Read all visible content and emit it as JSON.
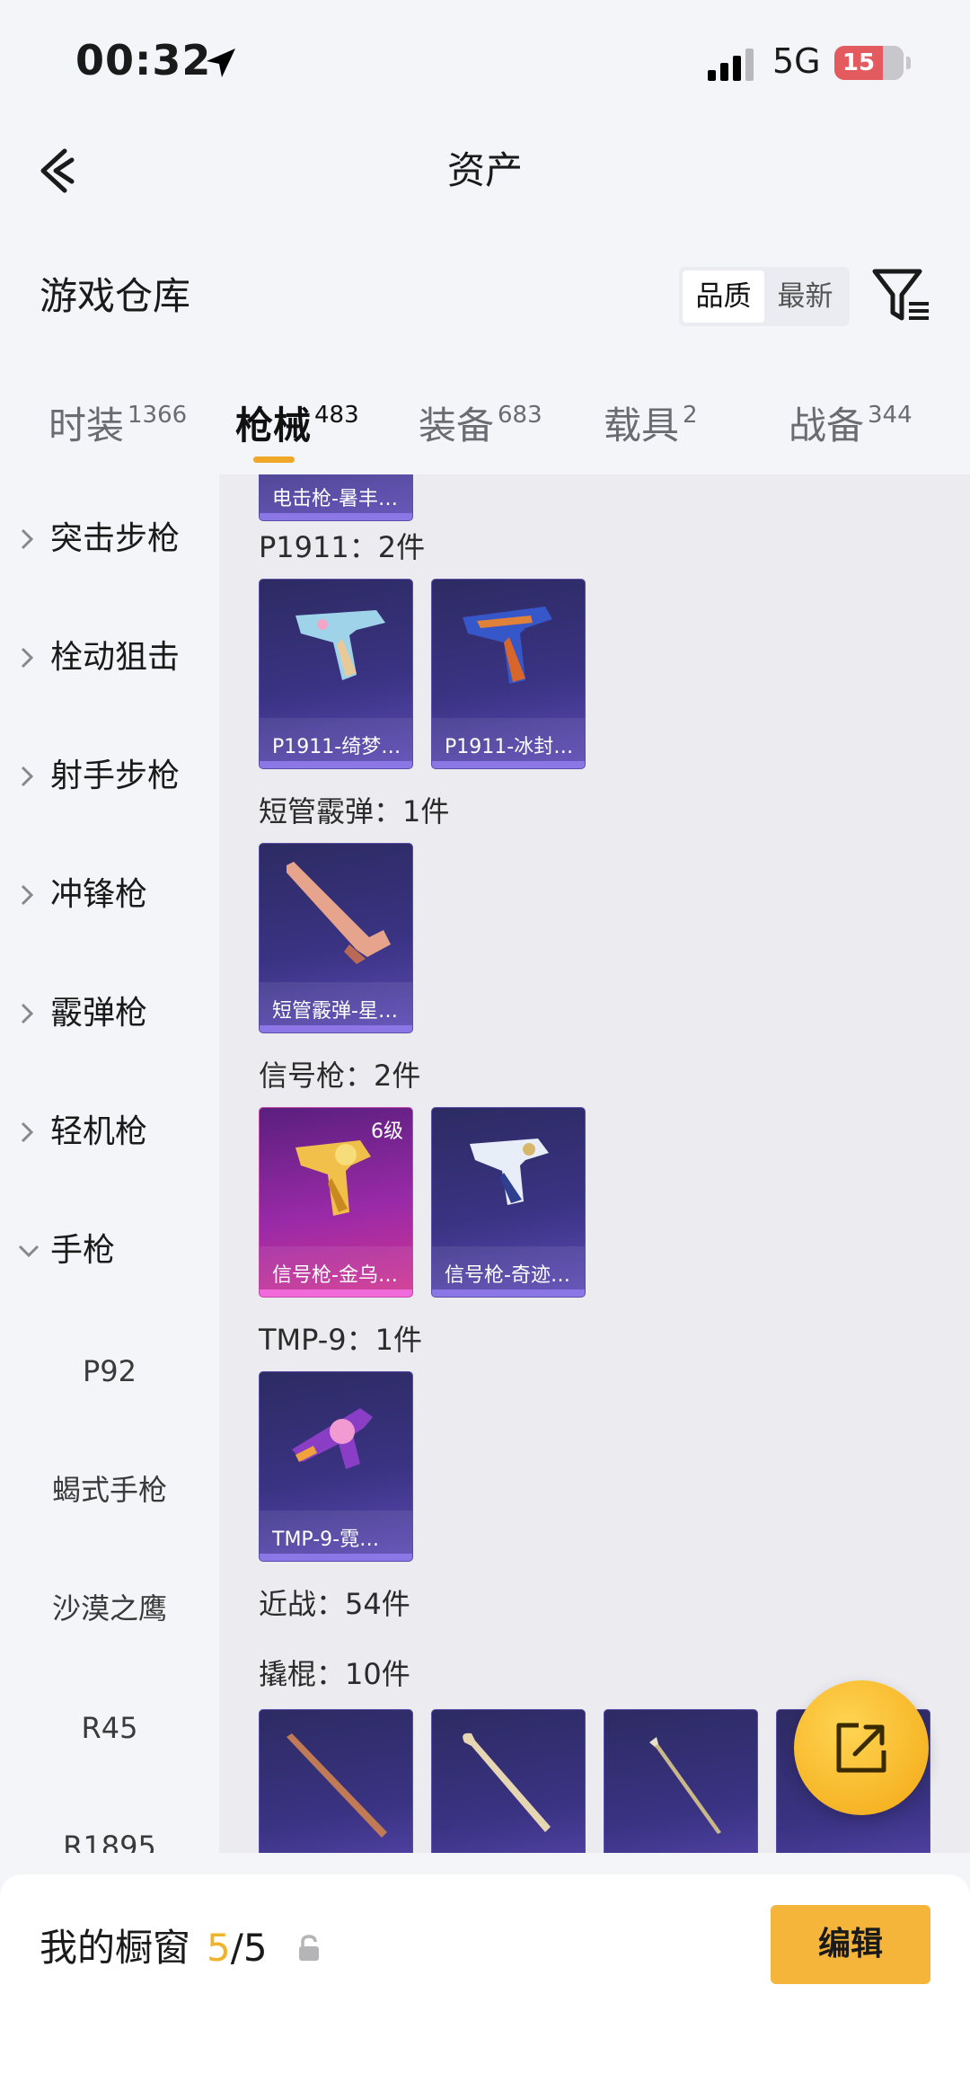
{
  "status_bar": {
    "time": "00:32",
    "network": "5G",
    "battery": "15"
  },
  "nav": {
    "title": "资产"
  },
  "warehouse": {
    "title": "游戏仓库",
    "sort_options": [
      "品质",
      "最新"
    ]
  },
  "tabs": [
    {
      "label": "时装",
      "count": "1366"
    },
    {
      "label": "枪械",
      "count": "483"
    },
    {
      "label": "装备",
      "count": "683"
    },
    {
      "label": "载具",
      "count": "2"
    },
    {
      "label": "战备",
      "count": "344"
    }
  ],
  "sidebar": {
    "categories": [
      "突击步枪",
      "栓动狙击",
      "射手步枪",
      "冲锋枪",
      "霰弹枪",
      "轻机枪",
      "手枪"
    ],
    "subcategories": [
      "P92",
      "蝎式手枪",
      "沙漠之鹰",
      "R45",
      "R1895"
    ]
  },
  "content": {
    "partial_card_label": "电击枪-暑丰…",
    "groups": [
      {
        "title": "P1911：2件",
        "items": [
          {
            "label": "P1911-绮梦…"
          },
          {
            "label": "P1911-冰封…"
          }
        ]
      },
      {
        "title": "短管霰弹：1件",
        "items": [
          {
            "label": "短管霰弹-星…"
          }
        ]
      },
      {
        "title": "信号枪：2件",
        "items": [
          {
            "label": "信号枪-金乌…",
            "level": "6级"
          },
          {
            "label": "信号枪-奇迹…"
          }
        ]
      },
      {
        "title": "TMP-9：1件",
        "items": [
          {
            "label": "TMP-9-霓…"
          }
        ]
      }
    ],
    "melee_title": "近战：54件",
    "crowbar_title": "撬棍：10件"
  },
  "bottom_bar": {
    "showcase_label": "我的橱窗",
    "count_current": "5",
    "count_total": "/5",
    "edit_label": "编辑"
  },
  "colors": {
    "accent": "#f2b32c",
    "card_purple": "#3a3383",
    "card_pink": "#9a2aa8"
  }
}
